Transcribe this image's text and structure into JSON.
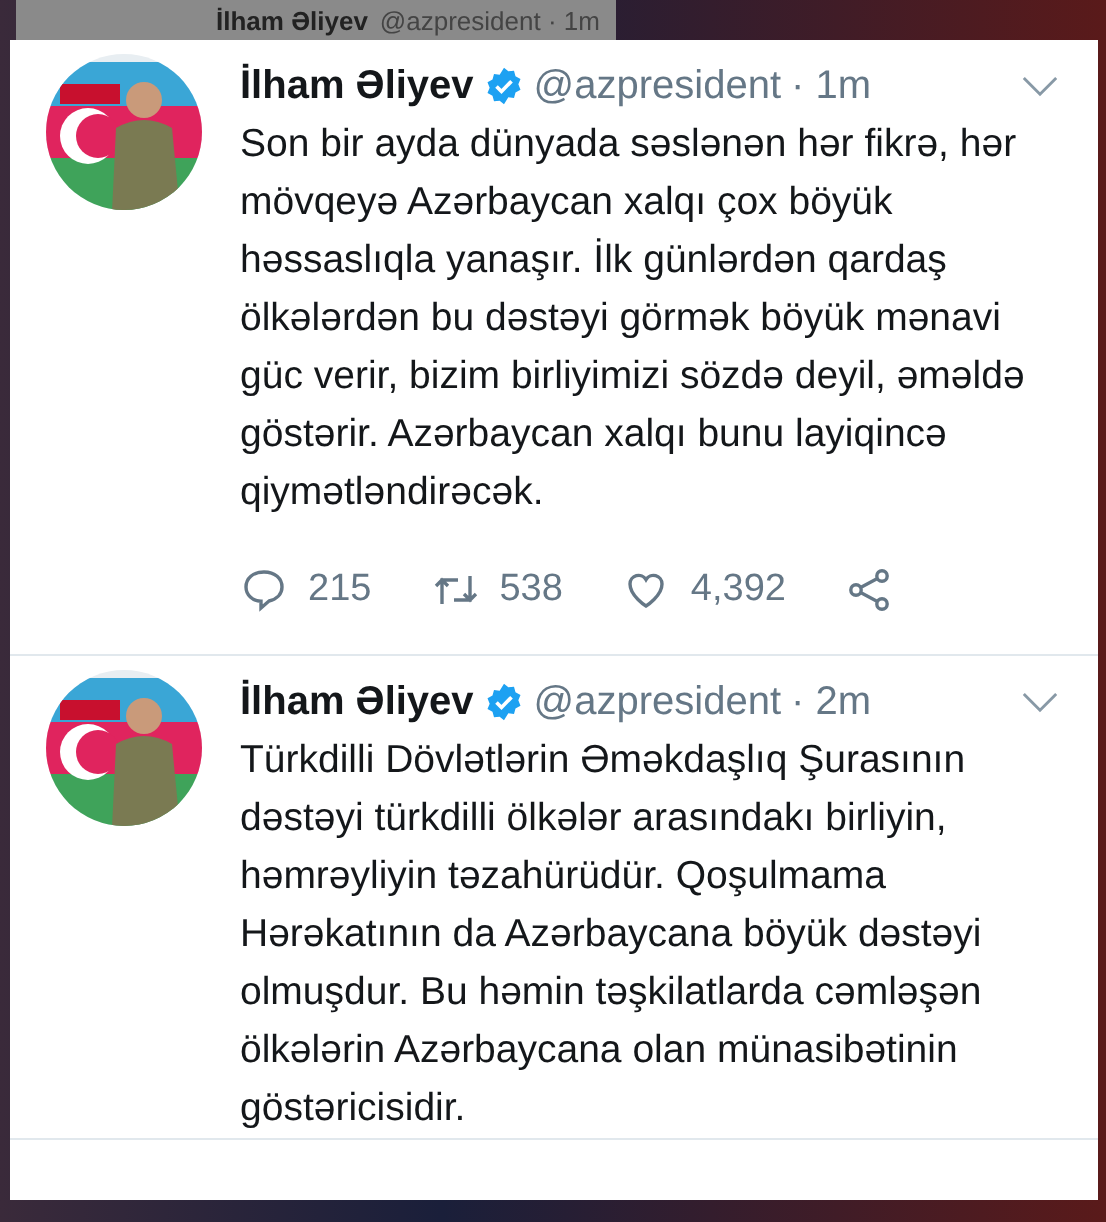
{
  "background_header": {
    "name": "İlham Əliyev",
    "handle": "@azpresident · 1m"
  },
  "tweets": [
    {
      "name": "İlham Əliyev",
      "verified": true,
      "handle": "@azpresident",
      "time": "· 1m",
      "text": "Son bir ayda dünyada səslənən hər fikrə, hər mövqeyə Azərbaycan xalqı çox böyük həssaslıqla yanaşır. İlk günlərdən qardaş ölkələrdən bu dəstəyi görmək böyük mənavi güc verir, bizim birliyimizi sözdə deyil, əməldə göstərir. Azərbaycan xalqı bunu layiqincə qiymətləndirəcək.",
      "actions": {
        "replies": "215",
        "retweets": "538",
        "likes": "4,392"
      }
    },
    {
      "name": "İlham Əliyev",
      "verified": true,
      "handle": "@azpresident",
      "time": "· 2m",
      "text": "Türkdilli Dövlətlərin Əməkdaşlıq Şurasının dəstəyi türkdilli ölkələr arasındakı birliyin, həmrəyliyin təzahürüdür. Qoşulmama Hərəkatının da Azərbaycana böyük dəstəyi olmuşdur. Bu həmin təşkilatlarda cəmləşən ölkələrin Azərbaycana olan münasibətinin göstəricisidir."
    }
  ]
}
